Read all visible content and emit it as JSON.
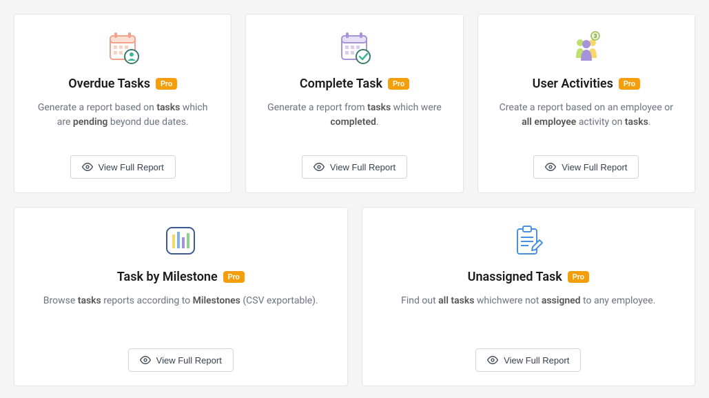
{
  "common": {
    "pro_label": "Pro",
    "view_report_label": "View Full Report"
  },
  "cards": {
    "overdue": {
      "title": "Overdue Tasks",
      "desc_pre": "Generate a report based on ",
      "desc_b1": "tasks",
      "desc_mid": " which are ",
      "desc_b2": "pending",
      "desc_post": " beyond due dates."
    },
    "complete": {
      "title": "Complete Task",
      "desc_pre": "Generate a report from ",
      "desc_b1": "tasks",
      "desc_mid": " which were ",
      "desc_b2": "completed",
      "desc_post": "."
    },
    "user_activities": {
      "title": "User Activities",
      "desc_pre": "Create a report based on an employee or ",
      "desc_b1": "all employee",
      "desc_mid": " activity on ",
      "desc_b2": "tasks",
      "desc_post": "."
    },
    "milestone": {
      "title": "Task by Milestone",
      "desc_pre": "Browse ",
      "desc_b1": "tasks",
      "desc_mid": " reports according to ",
      "desc_b2": "Milestones",
      "desc_post": " (CSV exportable)."
    },
    "unassigned": {
      "title": "Unassigned Task",
      "desc_pre": "Find out ",
      "desc_b1": "all tasks",
      "desc_mid": " whichwere not ",
      "desc_b2": "assigned",
      "desc_post": " to any employee."
    }
  }
}
